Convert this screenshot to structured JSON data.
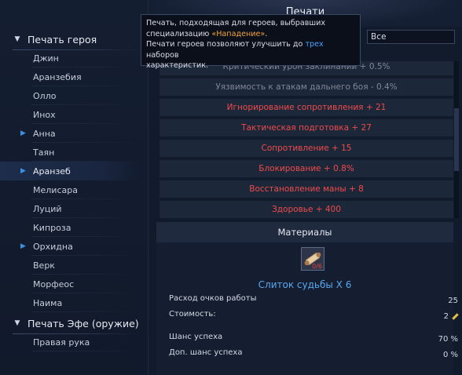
{
  "title": "Печати",
  "dropdown": {
    "value": "Все"
  },
  "sidebar": {
    "groups": [
      {
        "label": "Печать героя",
        "items": [
          {
            "label": "Джин",
            "marked": false,
            "selected": false
          },
          {
            "label": "Аранзебия",
            "marked": false,
            "selected": false
          },
          {
            "label": "Олло",
            "marked": false,
            "selected": false
          },
          {
            "label": "Инох",
            "marked": false,
            "selected": false
          },
          {
            "label": "Анна",
            "marked": true,
            "selected": false
          },
          {
            "label": "Таян",
            "marked": false,
            "selected": false
          },
          {
            "label": "Аранзеб",
            "marked": true,
            "selected": true
          },
          {
            "label": "Мелисара",
            "marked": false,
            "selected": false
          },
          {
            "label": "Луций",
            "marked": false,
            "selected": false
          },
          {
            "label": "Кипроза",
            "marked": false,
            "selected": false
          },
          {
            "label": "Орхидна",
            "marked": true,
            "selected": false
          },
          {
            "label": "Верк",
            "marked": false,
            "selected": false
          },
          {
            "label": "Морфеос",
            "marked": false,
            "selected": false
          },
          {
            "label": "Наима",
            "marked": false,
            "selected": false
          }
        ]
      },
      {
        "label": "Печать Эфе (оружие)",
        "items": [
          {
            "label": "Правая рука",
            "marked": false,
            "selected": false
          }
        ]
      }
    ]
  },
  "tooltip": {
    "line1": "Печать, подходящая для героев, выбравших",
    "line2_pre": "специализацию ",
    "line2_hl": "«Нападение»",
    "line2_post": ".",
    "line3_pre": "Печати героев позволяют улучшить до ",
    "line3_hl": "трех",
    "line3_post": " наборов",
    "line4": "характеристик."
  },
  "stats": [
    {
      "text": "Критический урон заклинаний + 0.5%",
      "dim": true
    },
    {
      "text": "Уязвимость к атакам дальнего боя - 0.4%",
      "dim": true
    },
    {
      "text": "Игнорирование сопротивления + 21",
      "dim": false
    },
    {
      "text": "Тактическая подготовка + 27",
      "dim": false
    },
    {
      "text": "Сопротивление + 15",
      "dim": false
    },
    {
      "text": "Блокирование + 0.8%",
      "dim": false
    },
    {
      "text": "Восстановление маны + 8",
      "dim": false
    },
    {
      "text": "Здоровье + 400",
      "dim": false
    }
  ],
  "materials": {
    "header": "Материалы",
    "item_count": "0/6",
    "item_name": "Слиток судьбы X 6",
    "rows": [
      {
        "label": "Расход очков работы",
        "value": "25"
      },
      {
        "label": "Стоимость:",
        "value": "2"
      },
      {
        "label": "Шанс успеха",
        "value": "70 %"
      },
      {
        "label": "Доп. шанс успеха",
        "value": "0 %"
      }
    ]
  },
  "colors": {
    "stat_red": "#ef4b4b",
    "item_blue": "#57a8f0",
    "tooltip_orange": "#f2a33a"
  }
}
